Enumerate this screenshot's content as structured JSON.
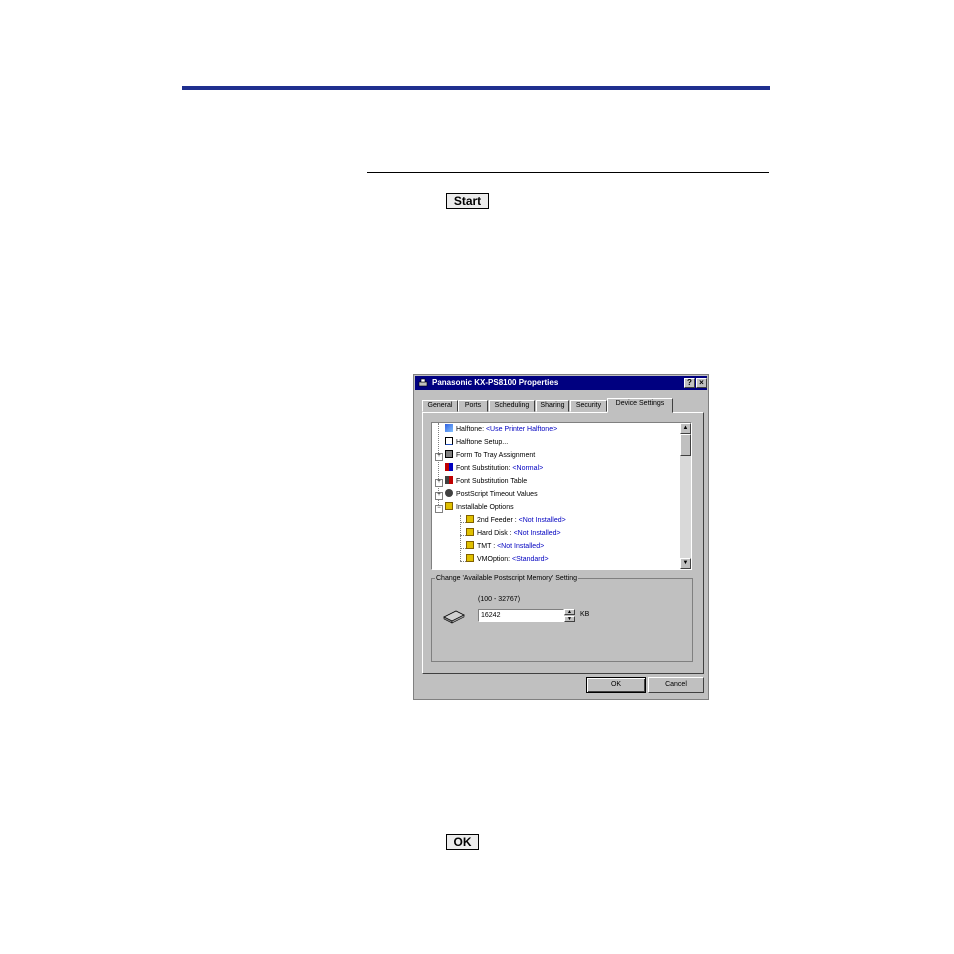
{
  "instructions": {
    "start_key": "Start",
    "ok_key": "OK"
  },
  "dialog": {
    "title": "Panasonic KX-PS8100 Properties",
    "help_button": "?",
    "close_button": "×",
    "tabs": [
      "General",
      "Ports",
      "Scheduling",
      "Sharing",
      "Security",
      "Device Settings"
    ],
    "active_tab": "Device Settings",
    "tree": [
      {
        "label": "Halftone: ",
        "value": "<Use Printer Halftone>",
        "icon": "halftone-icon"
      },
      {
        "label": "Halftone Setup...",
        "value": "",
        "icon": "halftone-setup-icon"
      },
      {
        "label": "Form To Tray Assignment",
        "value": "",
        "icon": "tray-icon"
      },
      {
        "label": "Font Substitution: ",
        "value": "<Normal>",
        "icon": "font-icon"
      },
      {
        "label": "Font Substitution Table",
        "value": "",
        "icon": "font-table-icon"
      },
      {
        "label": "PostScript Timeout Values",
        "value": "",
        "icon": "timeout-icon"
      },
      {
        "label": "Installable Options",
        "value": "",
        "icon": "options-folder-icon"
      },
      {
        "label": "2nd Feeder : ",
        "value": "<Not Installed>",
        "icon": "option-icon"
      },
      {
        "label": "Hard Disk : ",
        "value": "<Not Installed>",
        "icon": "option-icon"
      },
      {
        "label": "TMT : ",
        "value": "<Not Installed>",
        "icon": "option-icon"
      },
      {
        "label": "VMOption: ",
        "value": "<Standard>",
        "icon": "option-icon"
      }
    ],
    "group_label": "Change 'Available Postscript Memory' Setting",
    "range": "(100 - 32767)",
    "memory_value": "16242",
    "unit": "KB",
    "ok_label": "OK",
    "cancel_label": "Cancel",
    "colors": {
      "titlebar": "#000080",
      "face": "#c0c0c0",
      "value_text": "#0000c0"
    }
  }
}
